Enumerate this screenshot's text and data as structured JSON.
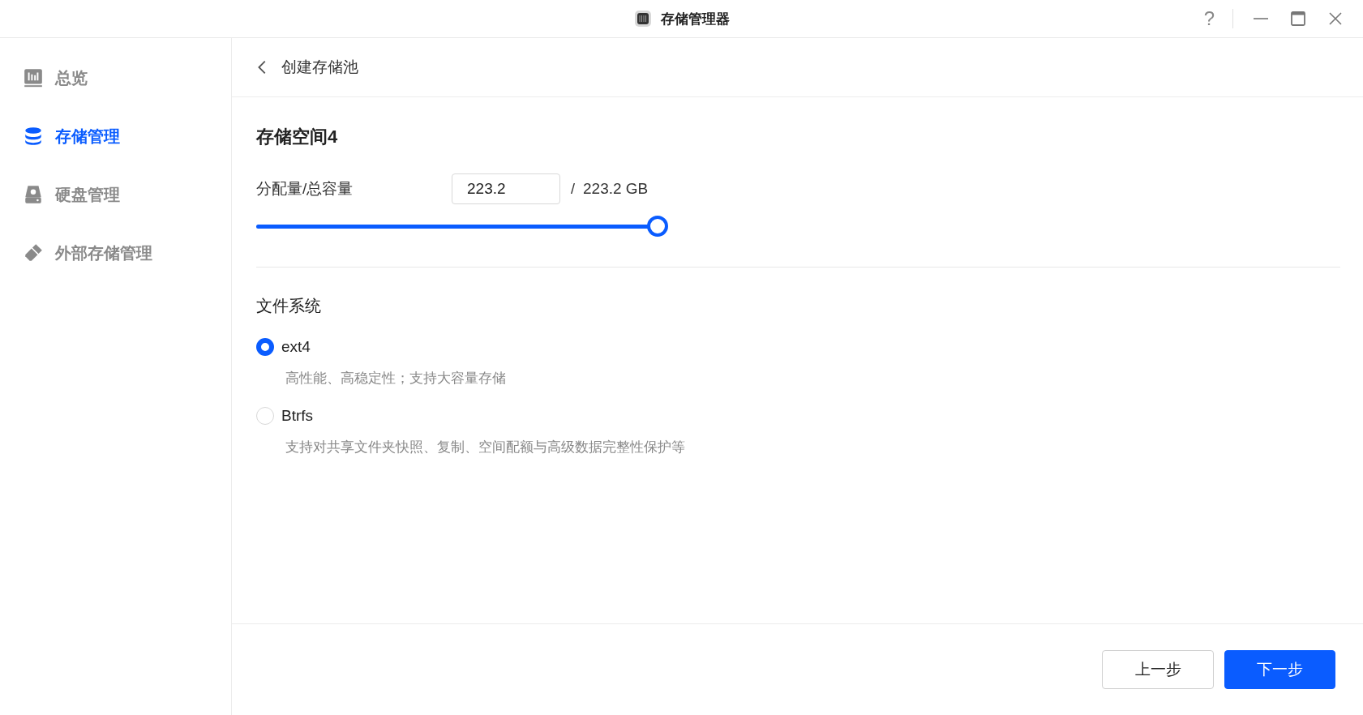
{
  "window": {
    "title": "存储管理器",
    "help": "?"
  },
  "sidebar": {
    "items": [
      {
        "label": "总览",
        "selected": false
      },
      {
        "label": "存储管理",
        "selected": true
      },
      {
        "label": "硬盘管理",
        "selected": false
      },
      {
        "label": "外部存储管理",
        "selected": false
      }
    ]
  },
  "header": {
    "title": "创建存储池"
  },
  "pool": {
    "title": "存储空间4",
    "allocation_label": "分配量/总容量",
    "allocation_value": "223.2",
    "separator": "/",
    "total": "223.2 GB",
    "slider": {
      "level": 1.0
    }
  },
  "filesystem": {
    "label": "文件系统",
    "options": [
      {
        "label": "ext4",
        "description": "高性能、高稳定性；支持大容量存储",
        "selected": true
      },
      {
        "label": "Btrfs",
        "description": "支持对共享文件夹快照、复制、空间配额与高级数据完整性保护等",
        "selected": false
      }
    ]
  },
  "buttons": [
    {
      "label": "上一步",
      "kind": "secondary"
    },
    {
      "label": "下一步",
      "kind": "primary"
    }
  ]
}
